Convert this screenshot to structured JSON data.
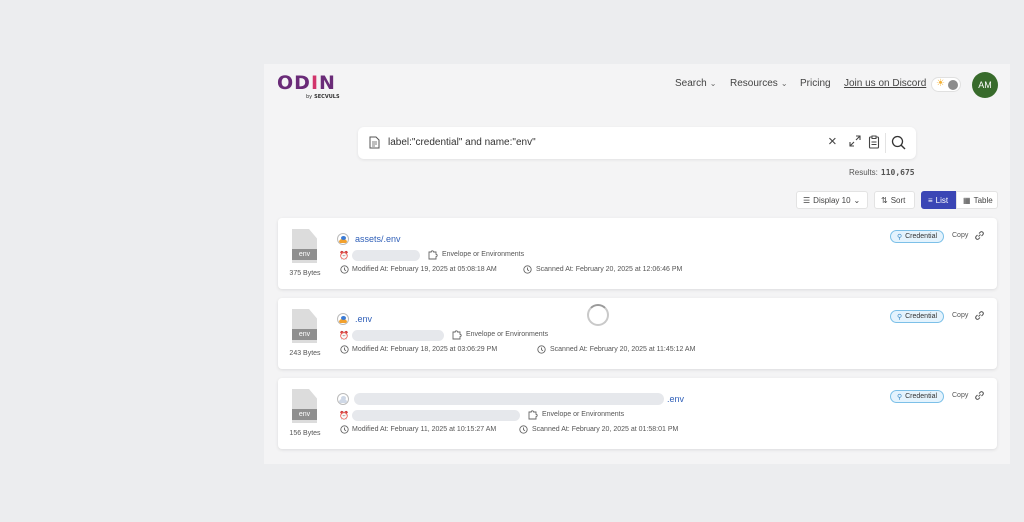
{
  "header": {
    "logo_text_a": "OD",
    "logo_text_b": "I",
    "logo_text_c": "N",
    "logo_by": "by",
    "logo_company": "SECVULS",
    "nav": {
      "search": "Search",
      "resources": "Resources",
      "pricing": "Pricing",
      "discord": "Join us on Discord"
    },
    "avatar_initials": "AM"
  },
  "search": {
    "query": "label:\"credential\" and name:\"env\"",
    "results_label": "Results:",
    "results_count": "110,675"
  },
  "toolbar": {
    "display": "Display 10",
    "sort": "Sort",
    "list": "List",
    "table": "Table"
  },
  "results": [
    {
      "file_ext": "env",
      "size": "375 Bytes",
      "name": "assets/.env",
      "category": "Envelope or Environments",
      "modified": "Modified At: February 19, 2025 at 05:08:18 AM",
      "scanned": "Scanned At: February 20, 2025 at 12:06:46 PM",
      "badge": "Credential",
      "copy": "Copy"
    },
    {
      "file_ext": "env",
      "size": "243 Bytes",
      "name": ".env",
      "category": "Envelope or Environments",
      "modified": "Modified At: February 18, 2025 at 03:06:29 PM",
      "scanned": "Scanned At: February 20, 2025 at 11:45:12 AM",
      "badge": "Credential",
      "copy": "Copy"
    },
    {
      "file_ext": "env",
      "size": "156 Bytes",
      "name": ".env",
      "category": "Envelope or Environments",
      "modified": "Modified At: February 11, 2025 at 10:15:27 AM",
      "scanned": "Scanned At: February 20, 2025 at 01:58:01 PM",
      "badge": "Credential",
      "copy": "Copy"
    }
  ],
  "colors": {
    "accent": "#3b46b5",
    "avatar": "#386b2c",
    "link": "#2f5fb8",
    "badge_bg": "#e4f3fd"
  },
  "icons": [
    "document-icon",
    "close-icon",
    "expand-icon",
    "clipboard-icon",
    "search-icon",
    "sun-icon",
    "chevron-down-icon",
    "sort-icon",
    "list-icon",
    "table-icon",
    "file-icon",
    "alarm-icon",
    "puzzle-icon",
    "clock-icon",
    "key-icon",
    "link-icon",
    "loading-spinner"
  ]
}
